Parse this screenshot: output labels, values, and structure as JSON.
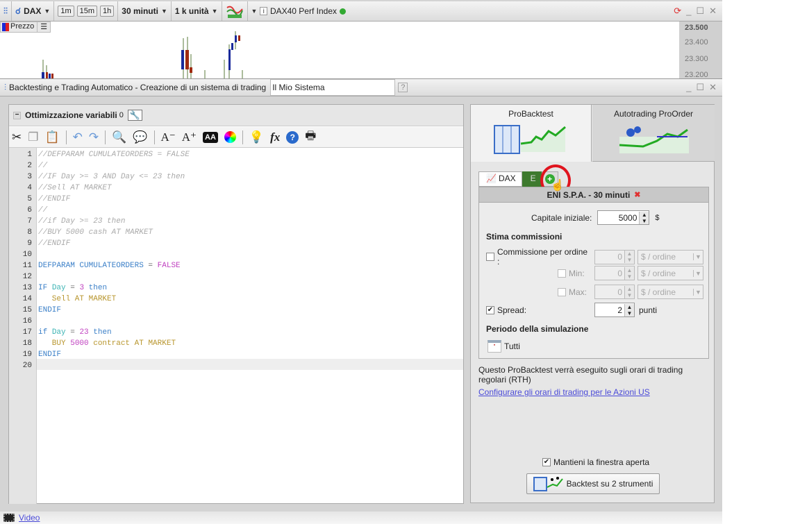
{
  "topbar": {
    "instrument": "DAX",
    "timeframes": [
      "1m",
      "15m",
      "1h"
    ],
    "period": "30 minuti",
    "units": "1 k unità",
    "instrument_name": "DAX40 Perf Index"
  },
  "chart": {
    "legend": "Prezzo",
    "price_ticks": [
      "23.500",
      "23.400",
      "23.300",
      "23.200"
    ]
  },
  "window": {
    "title": "Backtesting e Trading Automatico - Creazione di un sistema di trading",
    "system_name": "Il Mio Sistema"
  },
  "editor": {
    "optim_label": "Ottimizzazione variabili",
    "optim_count": "0",
    "lines": [
      [
        [
          "//DEFPARAM CUMULATEORDERS = FALSE",
          "com"
        ]
      ],
      [
        [
          "//",
          "com"
        ]
      ],
      [
        [
          "//IF Day >= 3 AND Day <= 23 then",
          "com"
        ]
      ],
      [
        [
          "//Sell AT MARKET",
          "com"
        ]
      ],
      [
        [
          "//ENDIF",
          "com"
        ]
      ],
      [
        [
          "//",
          "com"
        ]
      ],
      [
        [
          "//if Day >= 23 then",
          "com"
        ]
      ],
      [
        [
          "//BUY 5000 cash AT MARKET",
          "com"
        ]
      ],
      [
        [
          "//ENDIF",
          "com"
        ]
      ],
      [],
      [
        [
          "DEFPARAM CUMULATEORDERS",
          "kw"
        ],
        [
          " = ",
          "op"
        ],
        [
          "FALSE",
          "num"
        ]
      ],
      [],
      [
        [
          "IF ",
          "kw"
        ],
        [
          "Day",
          "var"
        ],
        [
          " = ",
          "op"
        ],
        [
          "3",
          "num"
        ],
        [
          " then",
          "kw"
        ]
      ],
      [
        [
          "   Sell AT MARKET",
          "ord"
        ]
      ],
      [
        [
          "ENDIF",
          "kw"
        ]
      ],
      [],
      [
        [
          "if ",
          "kw"
        ],
        [
          "Day",
          "var"
        ],
        [
          " = ",
          "op"
        ],
        [
          "23",
          "num"
        ],
        [
          " then",
          "kw"
        ]
      ],
      [
        [
          "   BUY ",
          "ord"
        ],
        [
          "5000",
          "num"
        ],
        [
          " contract AT MARKET",
          "ord"
        ]
      ],
      [
        [
          "ENDIF",
          "kw"
        ]
      ],
      []
    ]
  },
  "right": {
    "tab_backtest": "ProBacktest",
    "tab_autotrading": "Autotrading ProOrder",
    "inst_tabs": [
      "DAX",
      "E"
    ],
    "inst_header": "ENI S.P.A. - 30 minuti",
    "capital_label": "Capitale iniziale:",
    "capital_value": "5000",
    "currency": "$",
    "commissions_title": "Stima commissioni",
    "commission_label": "Commissione per ordine :",
    "commission_value": "0",
    "commission_unit": "$ / ordine",
    "commission_checked": false,
    "min_label": "Min:",
    "min_value": "0",
    "min_unit": "$ / ordine",
    "max_label": "Max:",
    "max_value": "0",
    "max_unit": "$ / ordine",
    "spread_label": "Spread:",
    "spread_value": "2",
    "spread_unit": "punti",
    "spread_checked": true,
    "period_title": "Periodo della simulazione",
    "period_value": "Tutti",
    "rth_note": "Questo ProBacktest verrà eseguito sugli orari di trading regolari (RTH)",
    "config_link": "Configurare gli orari di trading per le Azioni US",
    "keep_open_label": "Mantieni la finestra aperta",
    "keep_open_checked": true,
    "run_button": "Backtest su 2 strumenti"
  },
  "footer": {
    "video_link": "Video"
  }
}
